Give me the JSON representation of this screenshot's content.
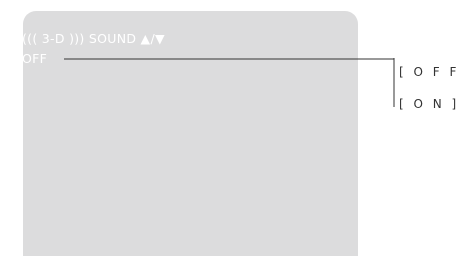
{
  "osd": {
    "title": "((( 3-D ))) SOUND ▲/▼",
    "current_value": "OFF"
  },
  "options": [
    {
      "label": "[ O F F ]"
    },
    {
      "label": "[ O N ]"
    }
  ],
  "colors": {
    "screen_background": "#dcdcdd",
    "osd_text": "#ffffff",
    "leader_line": "#333333",
    "option_text": "#333333"
  }
}
